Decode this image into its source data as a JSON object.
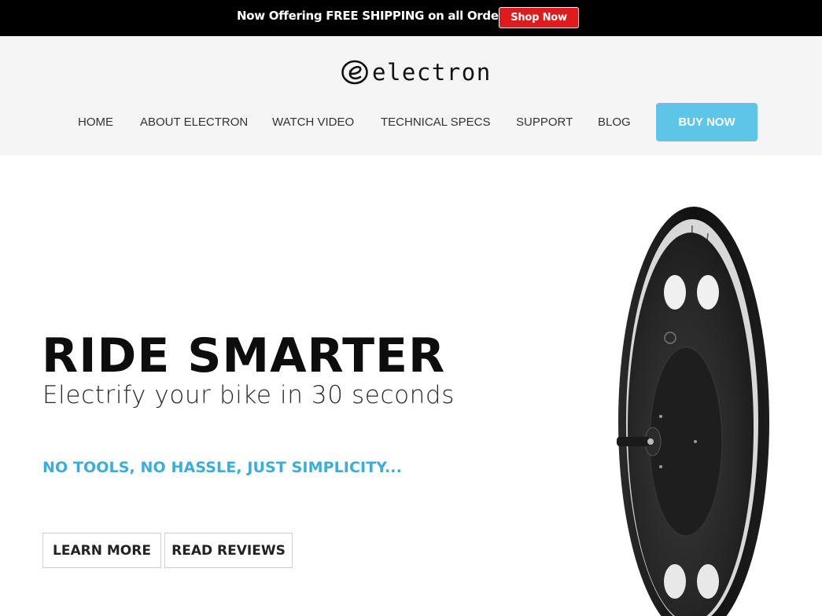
{
  "announcement": {
    "text": "Now Offering FREE SHIPPING on all Orders!",
    "button_label": "Shop Now"
  },
  "brand": {
    "name": "electron"
  },
  "nav": {
    "items": [
      "HOME",
      "ABOUT ELECTRON",
      "WATCH VIDEO",
      "TECHNICAL SPECS",
      "SUPPORT",
      "BLOG"
    ],
    "cta_label": "BUY NOW"
  },
  "hero": {
    "headline": "RIDE SMARTER",
    "subheadline": "Electrify your bike in 30 seconds",
    "tagline": "NO TOOLS, NO HASSLE, JUST SIMPLICITY...",
    "buttons": [
      "LEARN MORE",
      "READ REVIEWS"
    ]
  },
  "colors": {
    "announcement_bg": "#000000",
    "shop_now": "#e01b1b",
    "header_bg": "#f5f5f5",
    "accent": "#5ec4e8",
    "tagline": "#3aaed8"
  },
  "icons": {
    "logo": "electron-e-logo-icon",
    "product": "wheel-hub-motor-image"
  }
}
